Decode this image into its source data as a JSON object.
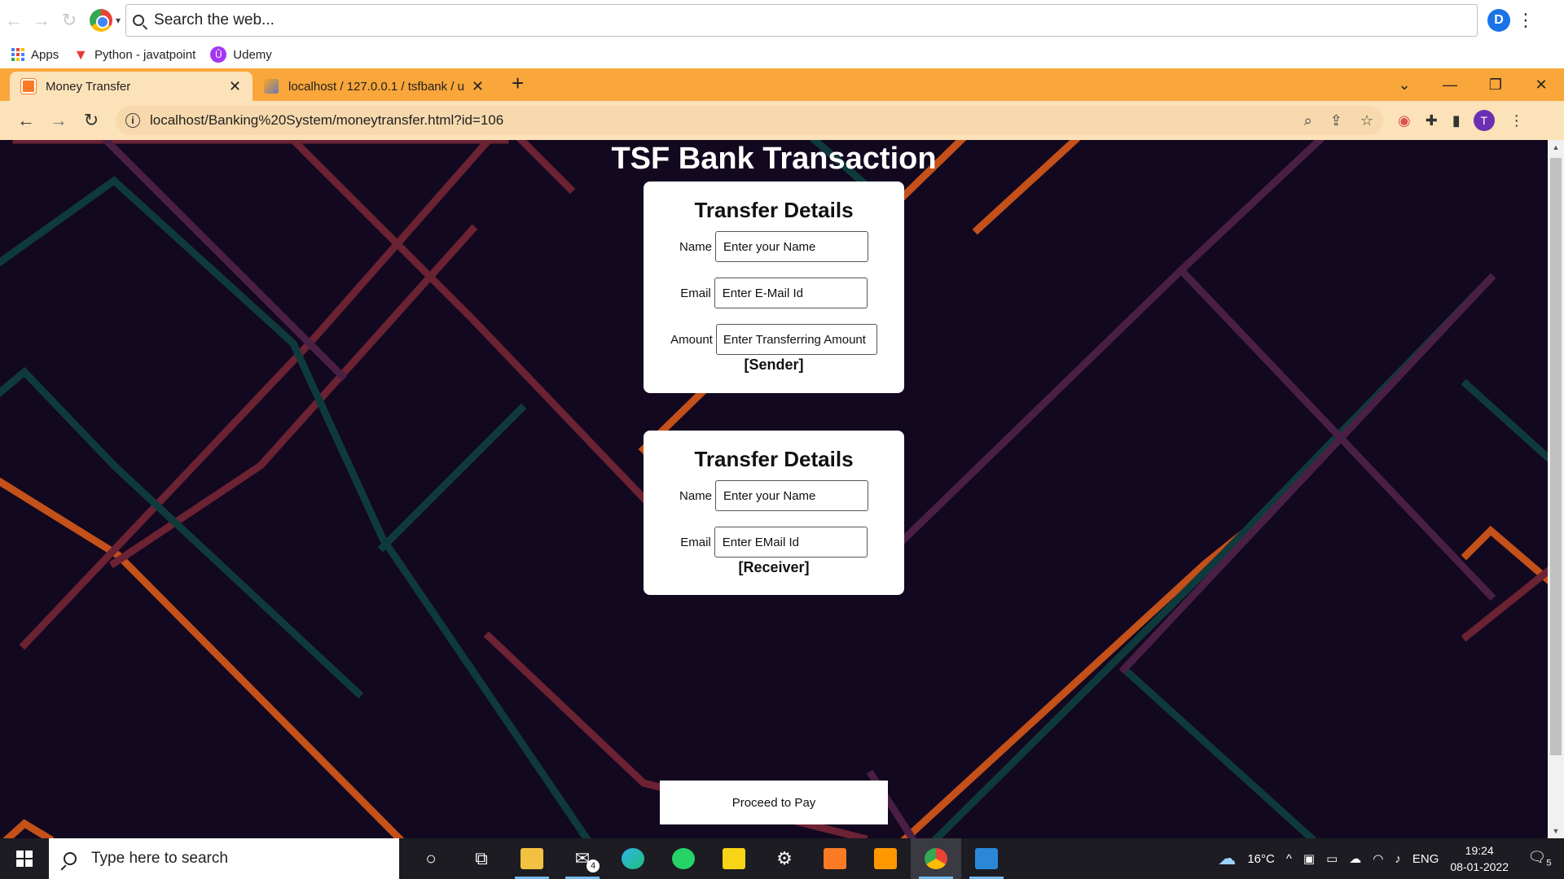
{
  "toolbar": {
    "search_placeholder": "Search the web..."
  },
  "bookmarks": [
    {
      "label": "Apps",
      "icon": "apps-grid-icon"
    },
    {
      "label": "Python - javatpoint",
      "icon": "javatpoint-icon"
    },
    {
      "label": "Udemy",
      "icon": "udemy-icon"
    }
  ],
  "tabs": [
    {
      "title": "Money Transfer",
      "active": true
    },
    {
      "title": "localhost / 127.0.0.1 / tsfbank / u",
      "active": false
    }
  ],
  "address": {
    "url": "localhost/Banking%20System/moneytransfer.html?id=106"
  },
  "profile": {
    "initial": "T",
    "extension_initial": "D"
  },
  "page": {
    "title": "TSF Bank Transaction",
    "sender_card": {
      "heading": "Transfer Details",
      "name_label": "Name",
      "name_placeholder": "Enter your Name",
      "email_label": "Email",
      "email_placeholder": "Enter E-Mail Id",
      "amount_label": "Amount",
      "amount_placeholder": "Enter Transferring Amount",
      "role": "[Sender]"
    },
    "receiver_card": {
      "heading": "Transfer Details",
      "name_label": "Name",
      "name_placeholder": "Enter your Name",
      "email_label": "Email",
      "email_placeholder": "Enter EMail Id",
      "role": "[Receiver]"
    },
    "proceed_label": "Proceed to Pay"
  },
  "colors": {
    "tabstrip": "#f9a63a",
    "page_bg": "#12081f",
    "line_orange": "#c4501a",
    "line_red": "#6b2233",
    "line_teal": "#0f3a3c",
    "line_purple": "#4a1f45"
  },
  "taskbar": {
    "search_placeholder": "Type here to search",
    "mail_badge": "4",
    "weather": "16°C",
    "language": "ENG",
    "time": "19:24",
    "date": "08-01-2022",
    "notifications": "5"
  }
}
